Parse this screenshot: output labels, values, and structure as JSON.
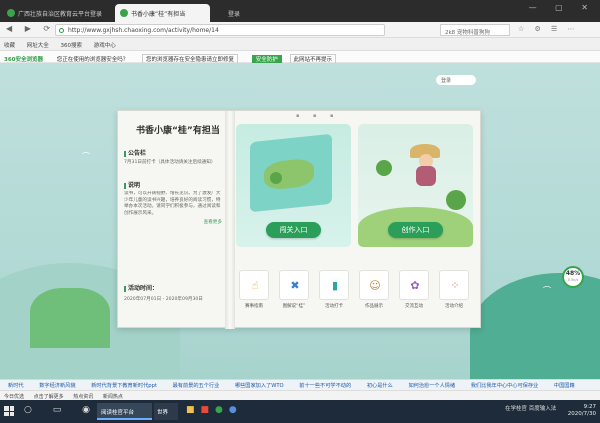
{
  "browser": {
    "tabs": [
      {
        "label": "广西壮族自治区教育云平台登录"
      },
      {
        "label": "书香小康“桂”有担当"
      },
      {
        "label": "登录"
      }
    ],
    "url": "http://www.gxjhsh.chaoxing.com/activity/home/14",
    "search_placeholder": "2k8 宠物科普狗狗",
    "favorites": [
      "收藏",
      "网址大全",
      "360搜索",
      "游戏中心"
    ],
    "warning": {
      "brand": "360安全浏览器",
      "question": "您正在使用的浏览器安全吗？",
      "message": "您的浏览器存在安全隐患请立即修复",
      "safe_button": "安全防护",
      "dismiss": "此网站不再提示"
    }
  },
  "page": {
    "crumb": "登录",
    "book_title": "书香小康“桂”有担当",
    "notice_heading": "公告栏",
    "notice_text": "7月31日前打卡（具体活动请关注后续通知）",
    "intro_heading": "说明",
    "intro_text": "读书，可以开阔视野、增长见识。为了激发广大少年儿童的读书兴趣，培养良好的阅读习惯，特举办本次活动。请同学们积极参与，通过阅读和创作展示风采。",
    "intro_more": "查看更多",
    "time_heading": "活动时间：",
    "time_text": "2020年07月01日 - 2020年09月30日",
    "checkpoint_button": "闯关入口",
    "create_button": "创作入口",
    "icons": [
      {
        "label": "赛事指南"
      },
      {
        "label": "图解说“桂”"
      },
      {
        "label": "活动打卡"
      },
      {
        "label": "作品展示"
      },
      {
        "label": "交流互动"
      },
      {
        "label": "活动介绍"
      }
    ],
    "progress_pct": "48%",
    "progress_sub": "0.5k/s"
  },
  "bottom_links": [
    "新时代",
    "数字经济新风貌",
    "新时代背景下教育新时代ppt",
    "最有前景的五个行业",
    "哪些国家加入了WTO",
    "前十一些不可学不动的",
    "初心是什么",
    "如何治愈一个人情绪",
    "我们比我年中心中心可保存业",
    "中国国籍"
  ],
  "statusbar": [
    "今日优选",
    "点击了解更多",
    "热点资讯",
    "新闻热点"
  ],
  "taskbar": {
    "window_title": "阅读桂官平台",
    "window2": "世界",
    "tray_text": "在学桂官 百度输入法",
    "time": "9:27",
    "date": "2020/7/30"
  }
}
